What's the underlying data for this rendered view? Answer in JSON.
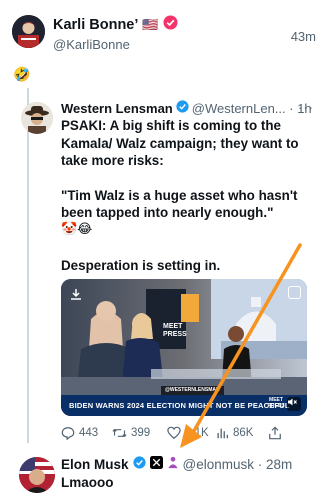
{
  "top_post": {
    "name": "Karli Bonne’",
    "flag": "🇺🇸",
    "handle": "@KarliBonne",
    "time": "43m",
    "emoji": "🤣"
  },
  "reply_post": {
    "name": "Western Lensman",
    "handle_time": "@WesternLen... · 1h",
    "more": "···",
    "body_paragraphs": [
      "PSAKI: A big shift is coming to the Kamala/ Walz campaign; they want to take more risks:",
      "\"Tim Walz is a huge asset who hasn't been tapped into nearly enough.\""
    ],
    "emojis": "🤡😂",
    "closing": "Desperation is setting in."
  },
  "video": {
    "chyron": "BIDEN WARNS 2024 ELECTION MIGHT NOT BE PEACEFUL",
    "tag": "@WESTERNLENSMAN",
    "network_logo": "MEET PRESS",
    "studio_sign": "MEET PRESS"
  },
  "actions": {
    "replies": "443",
    "reposts": "399",
    "likes": "2.1K",
    "views": "86K"
  },
  "bottom_reply": {
    "name": "Elon Musk",
    "handle_time": "@elonmusk · 28m",
    "body": "Lmaooo"
  },
  "colors": {
    "verified_blue": "#1d9bf0",
    "verified_pink": "#f4336a",
    "arrow_orange": "#f7931e",
    "chyron_navy": "#0a2f66"
  }
}
